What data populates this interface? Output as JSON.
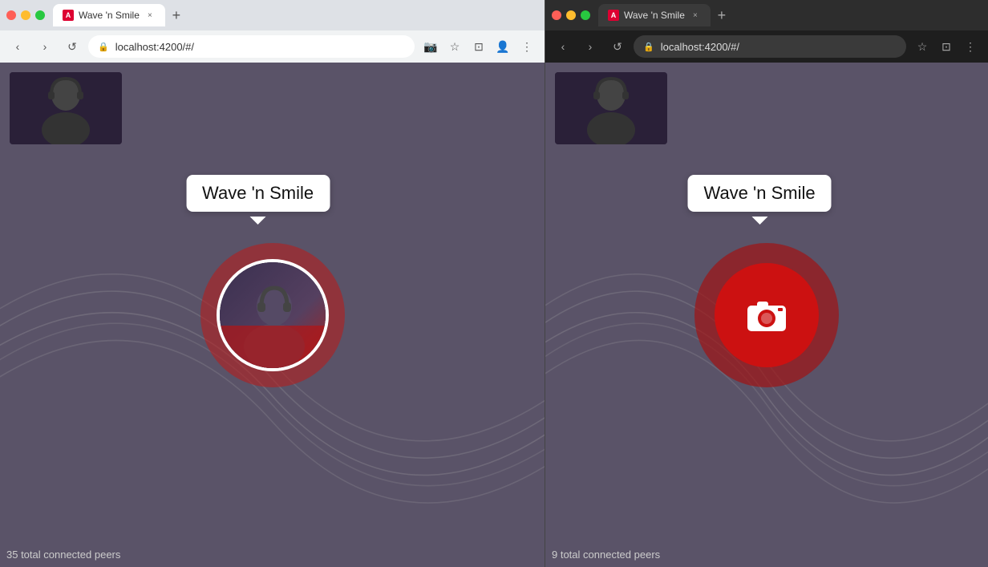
{
  "left_browser": {
    "tab_title": "Wave 'n Smile",
    "favicon_letter": "A",
    "address": "localhost:4200/#/",
    "close_btn": "×",
    "new_tab": "+",
    "nav_back": "‹",
    "nav_forward": "›",
    "nav_reload": "↺",
    "bubble_text": "Wave 'n Smile",
    "status_text": "35 total connected peers"
  },
  "right_browser": {
    "tab_title": "Wave 'n Smile",
    "favicon_letter": "A",
    "address": "localhost:4200/#/",
    "close_btn": "×",
    "new_tab": "+",
    "nav_back": "‹",
    "nav_forward": "›",
    "nav_reload": "↺",
    "bubble_text": "Wave 'n Smile",
    "status_text": "9 total connected peers"
  },
  "colors": {
    "app_bg": "#5a5368",
    "tab_bar_light": "#dee1e6",
    "tab_bar_dark": "#2d2d2d",
    "nav_bar_light": "#f1f3f4",
    "nav_bar_dark": "#1e1e1e",
    "tab_active_light": "#ffffff",
    "tab_active_dark": "#3a3a3a",
    "address_bar_light": "#ffffff",
    "address_bar_dark": "#3a3a3a",
    "accent_red": "#cc1111",
    "outer_red": "rgba(180,30,30,0.6)",
    "wave_color": "#888"
  }
}
